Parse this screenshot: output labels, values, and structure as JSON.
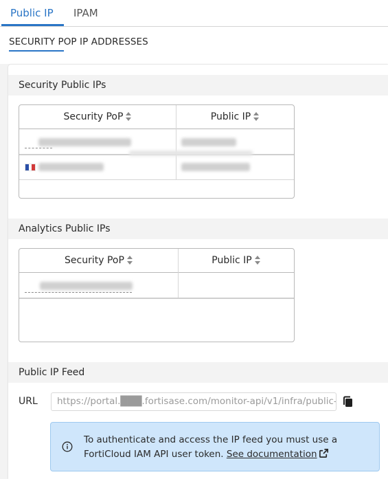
{
  "tabs": [
    {
      "label": "Public IP",
      "active": true
    },
    {
      "label": "IPAM",
      "active": false
    }
  ],
  "subtab": {
    "label": "SECURITY POP IP ADDRESSES"
  },
  "security_section": {
    "title": "Security Public IPs",
    "columns": [
      "Security PoP",
      "Public IP"
    ]
  },
  "analytics_section": {
    "title": "Analytics Public IPs",
    "columns": [
      "Security PoP",
      "Public IP"
    ]
  },
  "feed_section": {
    "title": "Public IP Feed",
    "url_label": "URL",
    "url_value": "https://portal.███.fortisase.com/monitor-api/v1/infra/public-",
    "info_text": "To authenticate and access the IP feed you must use a FortiCloud IAM API user token. ",
    "link_text": "See documentation"
  },
  "icons": {
    "sort": "sort-icon",
    "copy": "copy-icon",
    "info": "info-circle-icon",
    "external": "external-link-icon",
    "flag": "france-flag-icon"
  },
  "colors": {
    "accent": "#2a75c6",
    "info_bg": "#cfe6fb",
    "info_border": "#9ec9ef"
  }
}
